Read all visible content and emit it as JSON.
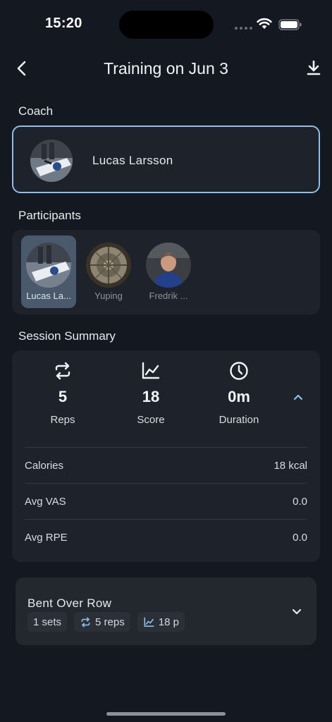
{
  "status_bar": {
    "time": "15:20"
  },
  "header": {
    "title": "Training on Jun 3"
  },
  "coach": {
    "section_label": "Coach",
    "name": "Lucas Larsson"
  },
  "participants": {
    "section_label": "Participants",
    "items": [
      {
        "name": "Lucas La...",
        "selected": true
      },
      {
        "name": "Yuping",
        "selected": false
      },
      {
        "name": "Fredrik ...",
        "selected": false
      }
    ]
  },
  "summary": {
    "section_label": "Session Summary",
    "stats": [
      {
        "icon": "repeat-icon",
        "value": "5",
        "label": "Reps"
      },
      {
        "icon": "line-chart-icon",
        "value": "18",
        "label": "Score"
      },
      {
        "icon": "clock-icon",
        "value": "0m",
        "label": "Duration"
      }
    ],
    "metrics": [
      {
        "label": "Calories",
        "value": "18 kcal"
      },
      {
        "label": "Avg VAS",
        "value": "0.0"
      },
      {
        "label": "Avg RPE",
        "value": "0.0"
      }
    ]
  },
  "exercises": [
    {
      "name": "Bent Over Row",
      "sets": "1 sets",
      "reps": "5 reps",
      "score": "18 p"
    }
  ],
  "colors": {
    "background": "#141820",
    "card": "#1d222b",
    "coach_border": "#8fbfe6",
    "accent": "#8fbfe6",
    "selected_participant": "#4a5a6c"
  }
}
